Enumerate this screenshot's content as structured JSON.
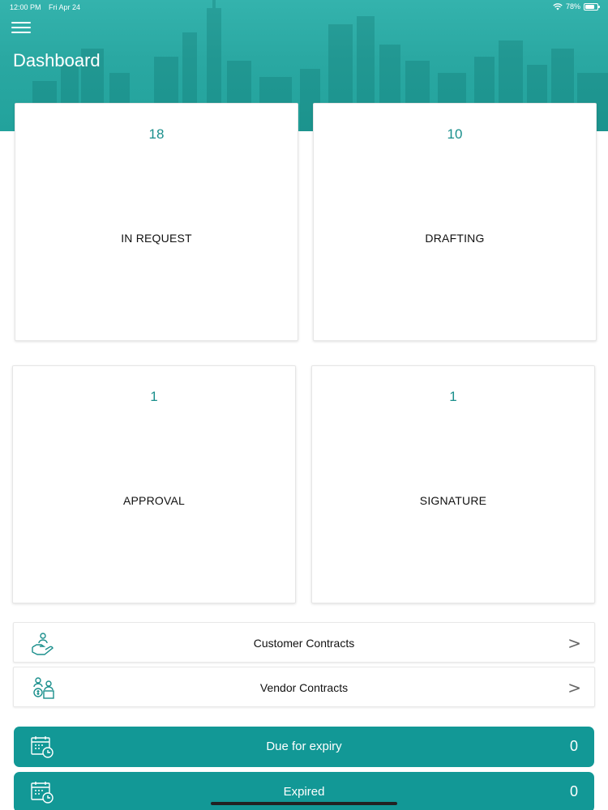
{
  "status_bar": {
    "time": "12:00 PM",
    "date": "Fri Apr 24",
    "battery": "78%",
    "battery_level": 0.78
  },
  "header": {
    "title": "Dashboard",
    "menu_icon": "hamburger-menu-icon"
  },
  "stats": [
    {
      "count": "18",
      "label": "IN REQUEST"
    },
    {
      "count": "10",
      "label": "DRAFTING"
    },
    {
      "count": "1",
      "label": "APPROVAL"
    },
    {
      "count": "1",
      "label": "SIGNATURE"
    }
  ],
  "contracts": [
    {
      "label": "Customer Contracts",
      "icon": "customer-hand-icon",
      "chevron": ">"
    },
    {
      "label": "Vendor Contracts",
      "icon": "vendor-icon",
      "chevron": ">"
    }
  ],
  "expiry": [
    {
      "label": "Due for expiry",
      "count": "0",
      "icon": "calendar-clock-icon"
    },
    {
      "label": "Expired",
      "count": "0",
      "icon": "calendar-clock-icon"
    }
  ],
  "colors": {
    "accent": "#129896",
    "header": "#2aa8a2",
    "count_text": "#1a8f8c"
  }
}
